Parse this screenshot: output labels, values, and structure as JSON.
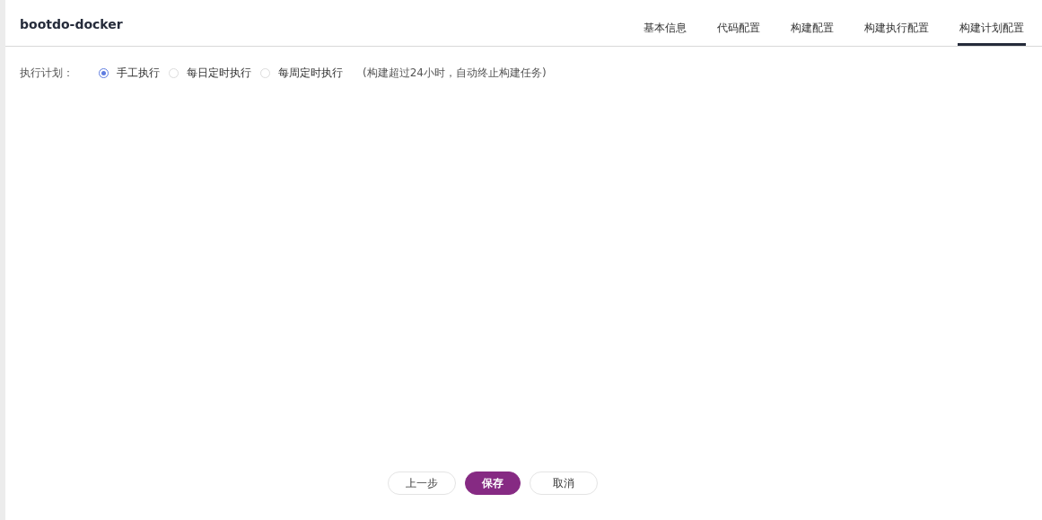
{
  "title": "bootdo-docker",
  "tabs": [
    {
      "label": "基本信息",
      "selected": false
    },
    {
      "label": "代码配置",
      "selected": false
    },
    {
      "label": "构建配置",
      "selected": false
    },
    {
      "label": "构建执行配置",
      "selected": false
    },
    {
      "label": "构建计划配置",
      "selected": true
    }
  ],
  "schedule": {
    "label": "执行计划：",
    "options": [
      {
        "label": "手工执行",
        "selected": true
      },
      {
        "label": "每日定时执行",
        "selected": false
      },
      {
        "label": "每周定时执行",
        "selected": false
      }
    ],
    "note": "(构建超过24小时，自动终止构建任务)"
  },
  "buttons": [
    {
      "label": "上一步",
      "kind": "default"
    },
    {
      "label": "保存",
      "kind": "primary"
    },
    {
      "label": "取消",
      "kind": "default"
    }
  ]
}
